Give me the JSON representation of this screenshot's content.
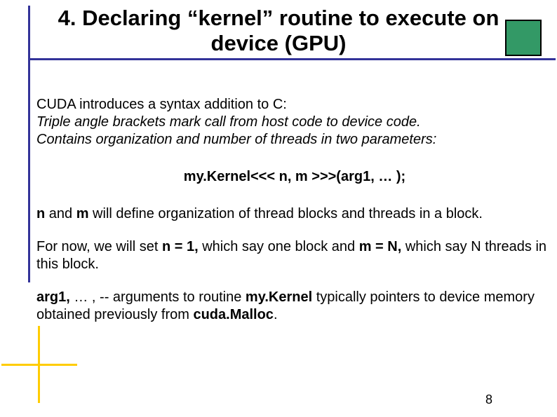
{
  "title": "4. Declaring “kernel” routine to execute on device (GPU)",
  "intro": "CUDA introduces a syntax addition to C:",
  "italic1": "Triple angle brackets mark call from host code to device code.",
  "italic2": "Contains organization and number of threads in two parameters:",
  "code": "my.Kernel<<< n, m >>>(arg1, … );",
  "p2_pre": "n",
  "p2_mid1": " and ",
  "p2_m": "m",
  "p2_after": " will define organization of thread blocks and threads in a block.",
  "p3_pre": "For now, we will set ",
  "p3_b1": "n = 1,",
  "p3_mid": " which say one block and ",
  "p3_b2": "m = N,",
  "p3_after": " which say N threads in this block.",
  "p4_b1": "arg1,",
  "p4_mid1": " … , -- arguments to routine ",
  "p4_b2": "my.Kernel",
  "p4_mid2": " typically pointers to device memory obtained previously from ",
  "p4_b3": "cuda.Malloc",
  "p4_end": ".",
  "page_number": "8"
}
